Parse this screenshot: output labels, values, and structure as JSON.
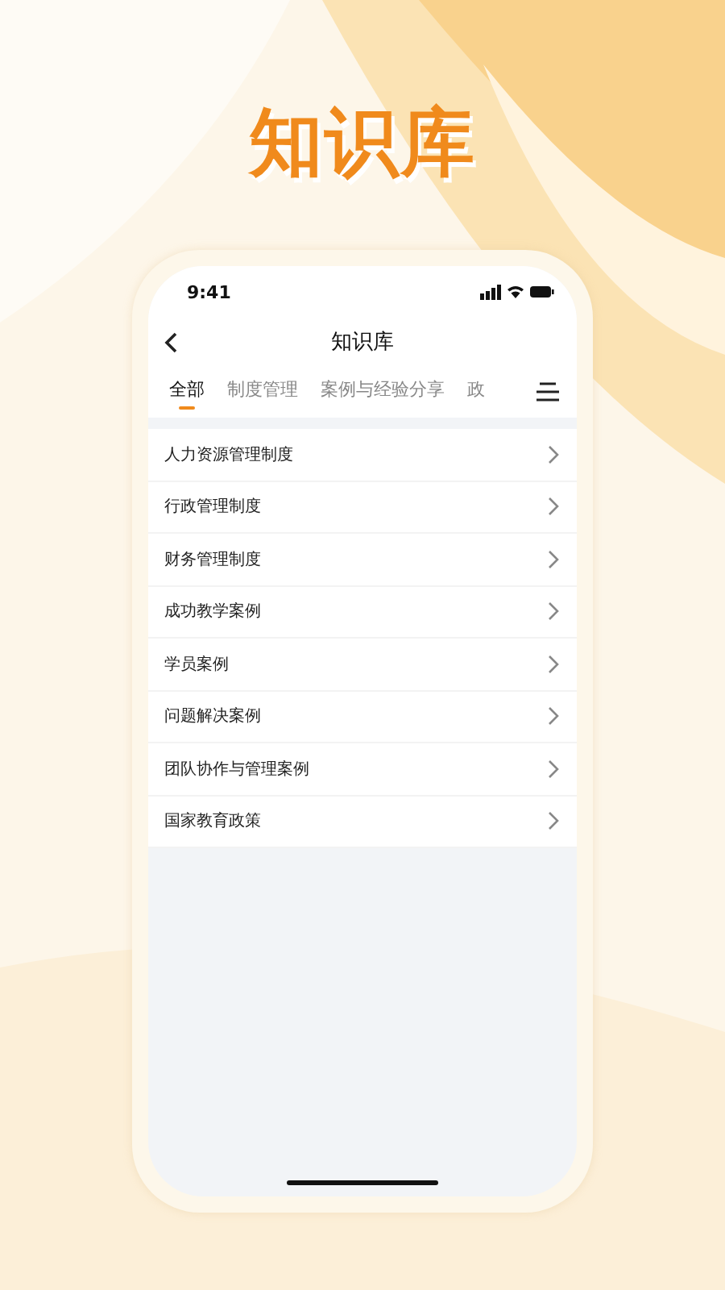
{
  "headline": "知识库",
  "status_bar": {
    "time": "9:41"
  },
  "nav": {
    "title": "知识库"
  },
  "tabs": [
    {
      "label": "全部",
      "selected": true
    },
    {
      "label": "制度管理",
      "selected": false
    },
    {
      "label": "案例与经验分享",
      "selected": false
    },
    {
      "label": "政",
      "selected": false
    }
  ],
  "items": [
    {
      "label": "人力资源管理制度"
    },
    {
      "label": "行政管理制度"
    },
    {
      "label": "财务管理制度"
    },
    {
      "label": "成功教学案例"
    },
    {
      "label": "学员案例"
    },
    {
      "label": "问题解决案例"
    },
    {
      "label": "团队协作与管理案例"
    },
    {
      "label": "国家教育政策"
    }
  ]
}
